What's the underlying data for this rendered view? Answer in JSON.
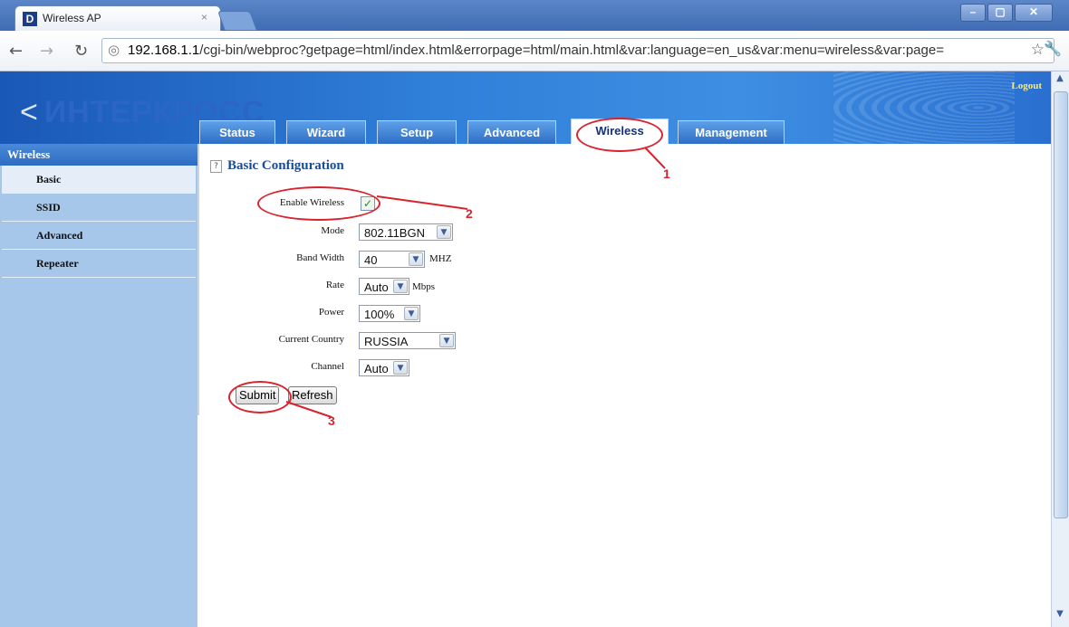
{
  "browser": {
    "tab_title": "Wireless AP",
    "tab_favicon": "D",
    "tab_close": "×",
    "url_host": "192.168.1.1",
    "url_path": "/cgi-bin/webproc?getpage=html/index.html&errorpage=html/main.html&var:language=en_us&var:menu=wireless&var:page="
  },
  "header": {
    "logo": "ИНТЕРКРОСС",
    "logout": "Logout",
    "tabs": [
      {
        "label": "Status"
      },
      {
        "label": "Wizard"
      },
      {
        "label": "Setup"
      },
      {
        "label": "Advanced"
      },
      {
        "label": "Wireless"
      },
      {
        "label": "Management"
      }
    ],
    "active_tab": "Wireless"
  },
  "sidebar": {
    "title": "Wireless",
    "items": [
      {
        "label": "Basic",
        "active": true
      },
      {
        "label": "SSID"
      },
      {
        "label": "Advanced"
      },
      {
        "label": "Repeater"
      }
    ]
  },
  "form": {
    "section_title": "Basic Configuration",
    "help_icon": "?",
    "enable_wireless_label": "Enable Wireless",
    "enable_wireless_checked": true,
    "mode_label": "Mode",
    "mode_value": "802.11BGN",
    "bandwidth_label": "Band Width",
    "bandwidth_value": "40",
    "bandwidth_unit": "MHZ",
    "rate_label": "Rate",
    "rate_value": "Auto",
    "rate_unit": "Mbps",
    "power_label": "Power",
    "power_value": "100%",
    "country_label": "Current Country",
    "country_value": "RUSSIA",
    "channel_label": "Channel",
    "channel_value": "Auto",
    "submit_label": "Submit",
    "refresh_label": "Refresh"
  },
  "annotations": {
    "one": "1",
    "two": "2",
    "three": "3",
    "color": "#d9232d"
  }
}
